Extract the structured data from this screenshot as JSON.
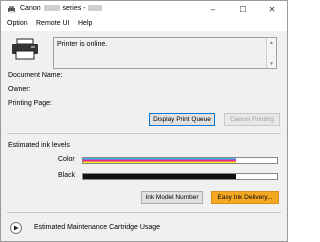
{
  "window": {
    "title_prefix": "Canon",
    "title_middle": "series -",
    "title_suffix": "",
    "controls": {
      "minimize": "–",
      "maximize": "☐",
      "close": "✕"
    }
  },
  "menu": [
    "Option",
    "Remote UI",
    "Help"
  ],
  "status": {
    "text": "Printer is online."
  },
  "fields": {
    "document_name": "Document Name:",
    "owner": "Owner:",
    "printing_page": "Printing Page:"
  },
  "buttons": {
    "display_print_queue": "Display Print Queue",
    "cancel_printing": "Cancel Printing",
    "ink_model_number": "Ink Model Number",
    "easy_ink_delivery": "Easy Ink Delivery..."
  },
  "ink": {
    "section_title": "Estimated ink levels",
    "levels": [
      {
        "name": "Color",
        "level": 0.79
      },
      {
        "name": "Black",
        "level": 0.79
      }
    ]
  },
  "maintenance": {
    "label": "Estimated Maintenance Cartridge Usage"
  },
  "colors": {
    "primary_border": "#0078d7",
    "easy_ink_button": "#f7a823",
    "black_ink": "#111111"
  }
}
